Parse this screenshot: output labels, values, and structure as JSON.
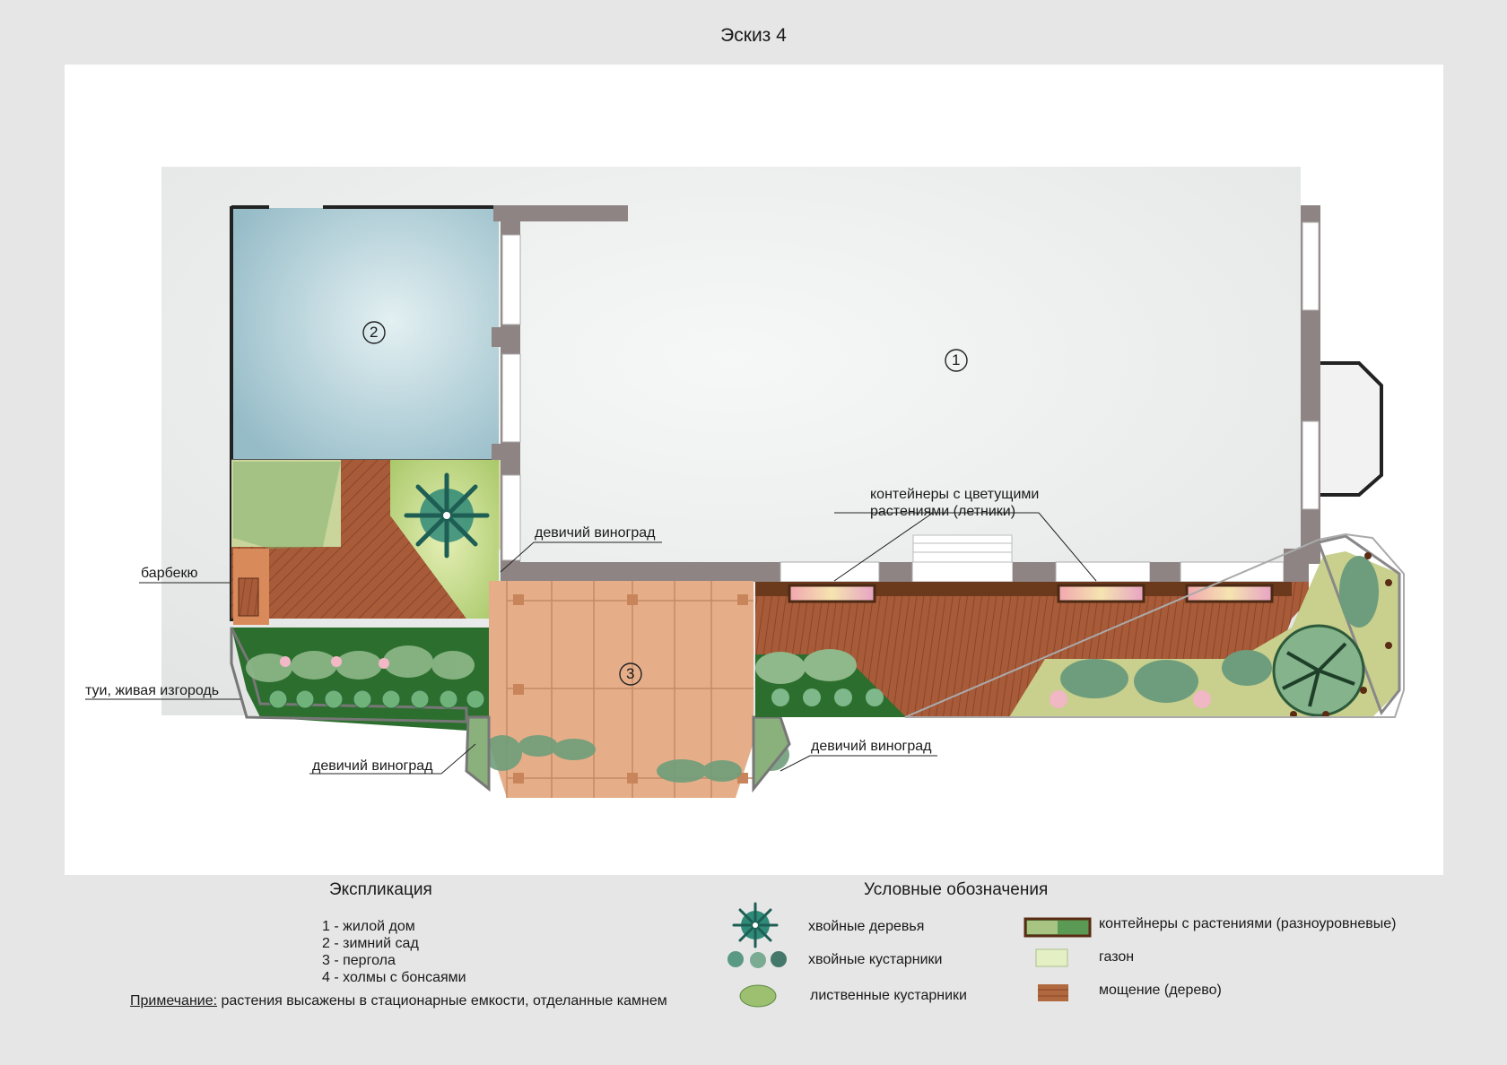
{
  "title": "Эскиз 4",
  "zones": [
    {
      "num": "1"
    },
    {
      "num": "2"
    },
    {
      "num": "3"
    }
  ],
  "callouts": {
    "containers": "контейнеры с цветущими",
    "containers2": "растениями (летники)",
    "vine_top": "девичий виноград",
    "bbq": "барбекю",
    "thuja": "туи, живая изгородь",
    "vine_left": "девичий виноград",
    "vine_right": "девичий виноград"
  },
  "explication": {
    "heading": "Экспликация",
    "items": [
      "1 - жилой дом",
      "2 - зимний сад",
      "3 - пергола",
      "4 - холмы с бонсаями"
    ],
    "note_label": "Примечание:",
    "note_text": " растения высажены в стационарные емкости, отделанные камнем"
  },
  "legend": {
    "heading": "Условные обозначения",
    "items": [
      {
        "label": "хвойные деревья",
        "icon": "conifer-tree-icon"
      },
      {
        "label": "хвойные кустарники",
        "icon": "conifer-shrub-icon"
      },
      {
        "label": "лиственные кустарники",
        "icon": "deciduous-shrub-icon"
      },
      {
        "label": "контейнеры с растениями (разноуровневые)",
        "icon": "container-icon"
      },
      {
        "label": "газон",
        "icon": "lawn-icon"
      },
      {
        "label": "мощение (дерево)",
        "icon": "wood-paving-icon"
      }
    ]
  },
  "colors": {
    "background": "#e6e6e6",
    "sheet": "#ffffff",
    "house": "#eceeee",
    "wall": "#8d8483",
    "winter_garden": "#a9c9d2",
    "wood": "#a85c3a",
    "pergola": "#e5ad87",
    "lawn": "#c9df9e",
    "hedge": "#2f6b2c"
  }
}
